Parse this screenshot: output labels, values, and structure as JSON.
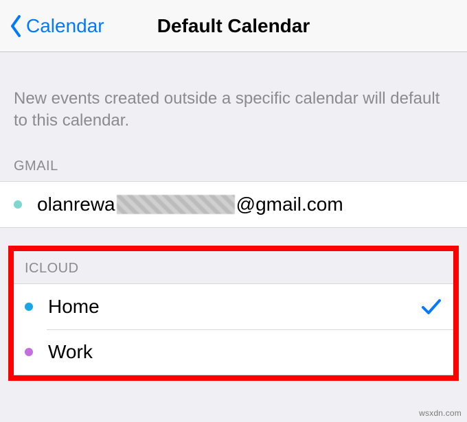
{
  "nav": {
    "back_label": "Calendar",
    "title": "Default Calendar"
  },
  "description": "New events created outside a specific calendar will default to this calendar.",
  "sections": {
    "gmail": {
      "header": "GMAIL",
      "item": {
        "prefix": "olanrewa",
        "suffix": "@gmail.com",
        "dot_color": "#7fd6d0",
        "selected": false
      }
    },
    "icloud": {
      "header": "ICLOUD",
      "items": [
        {
          "label": "Home",
          "dot_color": "#1aa6e1",
          "selected": true
        },
        {
          "label": "Work",
          "dot_color": "#c46fe0",
          "selected": false
        }
      ]
    }
  },
  "icons": {
    "back": "chevron-left-icon",
    "check": "checkmark-icon"
  },
  "watermark": "wsxdn.com"
}
